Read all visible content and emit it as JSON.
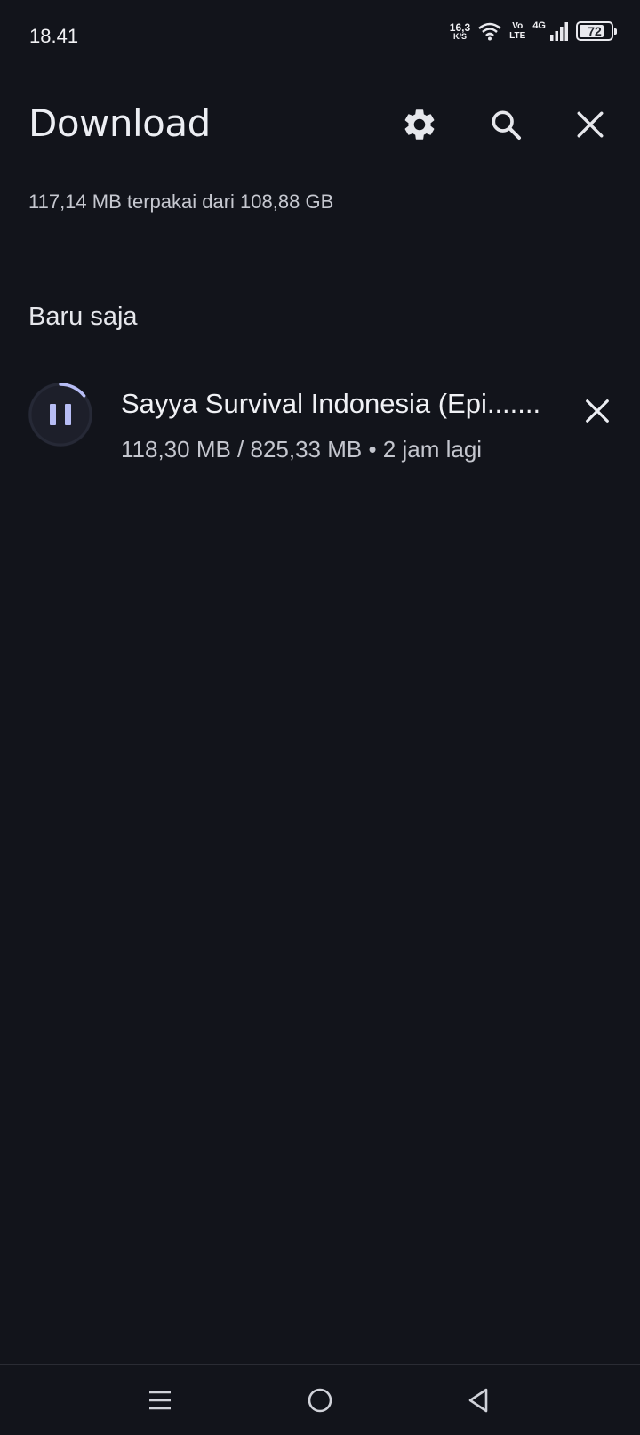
{
  "status_bar": {
    "time": "18.41",
    "net_speed": "16,3",
    "net_speed_unit": "K/S",
    "volte_top": "Vo",
    "volte_bottom": "LTE",
    "network": "4G",
    "battery": "72"
  },
  "header": {
    "title": "Download",
    "icons": [
      "gear-icon",
      "search-icon",
      "close-icon"
    ]
  },
  "storage_info": "117,14 MB terpakai dari 108,88 GB",
  "section_title": "Baru saja",
  "downloads": [
    {
      "title": "Sayya Survival Indonesia (Epi.......",
      "subtitle": "118,30 MB / 825,33 MB • 2 jam lagi",
      "progress": 0.143,
      "state_icon": "pause-icon"
    }
  ],
  "nav_bar": {
    "icons": [
      "menu-icon",
      "home-icon",
      "back-icon"
    ]
  },
  "colors": {
    "background": "#12141b",
    "accent": "#b7bdf5",
    "text": "#e6e7ec"
  }
}
